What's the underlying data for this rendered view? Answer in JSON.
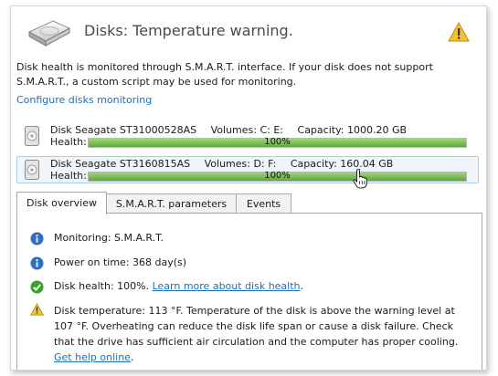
{
  "header": {
    "title": "Disks: Temperature warning.",
    "logo_icon": "hard-disk-icon",
    "status_icon": "warning-icon"
  },
  "description": "Disk health is monitored through S.M.A.R.T. interface. If your disk does not support S.M.A.R.T., a custom script may be used for monitoring.",
  "configure_link": "Configure disks monitoring",
  "disks": [
    {
      "name": "Disk Seagate ST31000528AS",
      "volumes": "Volumes: C: E:",
      "capacity": "Capacity: 1000.20 GB",
      "health_label": "Health:",
      "health_text": "100%",
      "health_value": 1.0,
      "selected": false
    },
    {
      "name": "Disk Seagate ST3160815AS",
      "volumes": "Volumes: D: F:",
      "capacity": "Capacity: 160.04 GB",
      "health_label": "Health:",
      "health_text": "100%",
      "health_value": 1.0,
      "selected": true
    }
  ],
  "tabs": [
    {
      "label": "Disk overview",
      "active": true
    },
    {
      "label": "S.M.A.R.T. parameters",
      "active": false
    },
    {
      "label": "Events",
      "active": false
    }
  ],
  "overview": {
    "monitoring": "Monitoring: S.M.A.R.T.",
    "power_on_label": "Power on time:",
    "power_on_value": "368 day(s)",
    "health_text": "Disk health: 100%.",
    "health_link": "Learn more about disk health",
    "health_link_suffix": ".",
    "temperature_text": "Disk temperature: 113 °F. Temperature of the disk is above the warning level at 107 °F. Overheating can reduce the disk life span or cause a disk failure. Check that the drive has sufficient air circulation and the computer has proper cooling.",
    "temperature_link": "Get help online",
    "temperature_link_suffix": "."
  },
  "colors": {
    "accent_link": "#1c6fb8",
    "health_bar": "#5da83a",
    "info_icon": "#2f6fc2",
    "ok_icon": "#3aa02a",
    "warning_icon": "#f2c232"
  }
}
